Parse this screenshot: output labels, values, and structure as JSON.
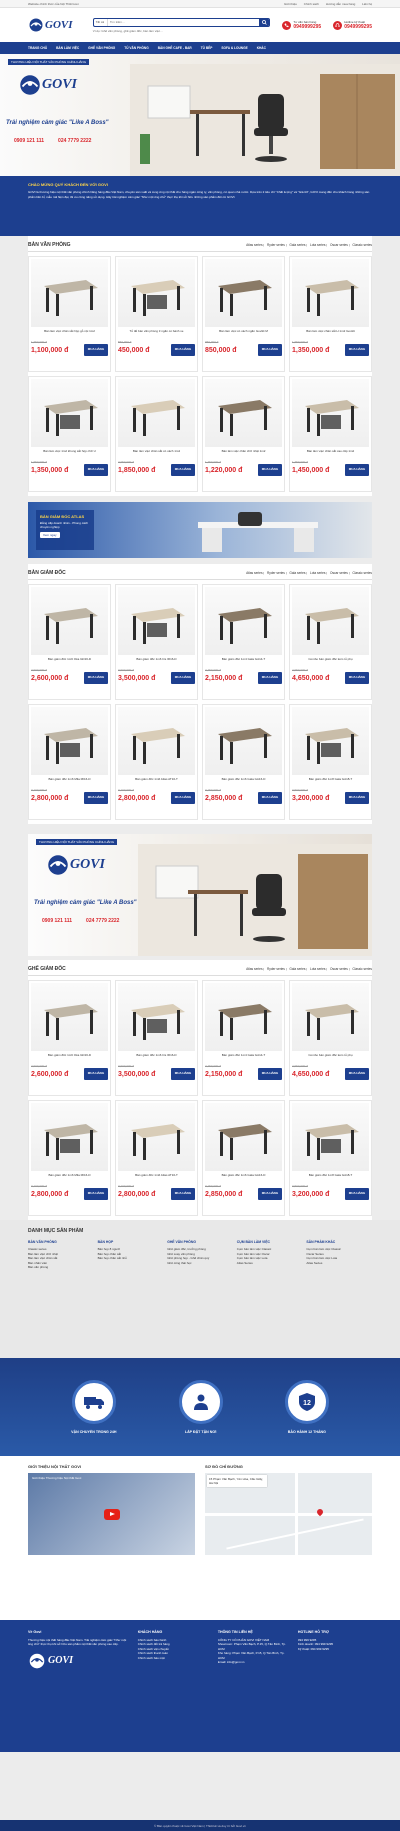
{
  "topbar": {
    "left": "Website chính thức của Nội Thất Govi",
    "links": [
      "Giới thiệu",
      "Chính sách",
      "Hướng dẫn mua hàng",
      "Liên hệ"
    ]
  },
  "header": {
    "logo_text": "GOVI",
    "search_category": "Tất cả",
    "search_placeholder": "Tìm kiếm...",
    "search_hint": "Ví dụ: Ghế văn phòng, ghế giám đốc, bàn làm việc...",
    "hotline_label": "Tư vấn bán hàng",
    "hotline_number": "0949999295",
    "hotline2_label": "Hotline kỹ thuật",
    "hotline2_number": "0949999295"
  },
  "nav": [
    "TRANG CHỦ",
    "BÀN LÀM VIỆC",
    "GHẾ VĂN PHÒNG",
    "TỦ VĂN PHÒNG",
    "BÀN GHẾ CAFE - BAR",
    "TỦ BẾP",
    "SOFA & LOUNGE",
    "KHÁC"
  ],
  "banner": {
    "tag": "THƯƠNG HIỆU NỘI THẤT VĂN PHÒNG CHÍNH HÃNG",
    "brand": "GOVI",
    "slogan": "Trải nghiệm cảm giác \"Like A Boss\"",
    "phone1": "0909 121 111",
    "phone2": "024 7779 2222"
  },
  "welcome": {
    "title": "CHÀO MỪNG QUÝ KHÁCH ĐẾN VỚI GOVI",
    "text": "GOVI là thương hiệu nội thất văn phòng chính hãng hàng đầu Việt Nam, chuyên sản xuất và cung ứng nội thất cho hàng ngàn công ty, văn phòng, cơ quan nhà nước. Dựa trên 2 tiêu chí \"Chất lượng\" và \"Giá tốt\", GOVI mang đến cho khách hàng những sản phẩm bền bỉ, mẫu mã hiện đại, tối ưu công năng sử dụng. Hãy trải nghiệm cảm giác \"Như một ông chủ\" thực thụ khi sở hữu những sản phẩm đến từ GOVI."
  },
  "sections": [
    {
      "title": "BÀN VĂN PHÒNG",
      "tabs": [
        "Atlas series",
        "Ryder series",
        "Gala series",
        "Lota series",
        "Oscar series",
        "Classic series"
      ]
    },
    {
      "title": "BÀN GIÁM ĐỐC",
      "tabs": [
        "Atlas series",
        "Ryder series",
        "Gala series",
        "Lota series",
        "Oscar series",
        "Classic series"
      ]
    },
    {
      "title": "GHẾ GIÁM ĐỐC",
      "tabs": [
        "Atlas series",
        "Ryder series",
        "Gala series",
        "Lota series",
        "Oscar series",
        "Classic series"
      ]
    }
  ],
  "buy_label": "MUA HÀNG",
  "products_office": [
    {
      "name": "Bàn làm việc chân sắt hộp gỗ nội 1m2",
      "old": "1,350,000 đ",
      "price": "1,100,000 đ"
    },
    {
      "name": "Tủ để bàn văn phòng 3 ngăn có bánh xe",
      "old": "550,000 đ",
      "price": "450,000 đ"
    },
    {
      "name": "Bàn làm việc có vách ngăn Goviết M",
      "old": "950,000 đ",
      "price": "850,000 đ"
    },
    {
      "name": "Bàn làm việc chân sắt H 1m2 Goviết",
      "old": "1,650,000 đ",
      "price": "1,350,000 đ"
    },
    {
      "name": "Bàn làm việc 1m2 khung sắt hộp chữ U",
      "old": "1,650,000 đ",
      "price": "1,350,000 đ"
    },
    {
      "name": "Bàn làm việc chân sắt có vách 1m4",
      "old": "2,050,000 đ",
      "price": "1,850,000 đ"
    },
    {
      "name": "Bàn làm việc chân chữ nhật 1m2",
      "old": "1,450,000 đ",
      "price": "1,220,000 đ"
    },
    {
      "name": "Bàn làm việc chân sắt cao cấp 1m2",
      "old": "1,750,000 đ",
      "price": "1,450,000 đ"
    }
  ],
  "promo": {
    "title": "BÀN GIÁM ĐỐC ATLAS",
    "text": "Đẳng cấp doanh nhân - Phong cách chuyên nghiệp",
    "button": "Xem ngay"
  },
  "products_exec": [
    {
      "name": "Bàn giám đốc 1m6 Oka GD16-D",
      "old": "2,900,000 đ",
      "price": "2,600,000 đ"
    },
    {
      "name": "Bàn giám đốc 1m6 Iris IR16-D",
      "old": "3,900,000 đ",
      "price": "3,500,000 đ"
    },
    {
      "name": "Bàn giám đốc 1m4 Gala GA14-T",
      "old": "2,450,000 đ",
      "price": "2,150,000 đ"
    },
    {
      "name": "Combo bàn giám đốc kèm tủ phụ",
      "old": "4,950,000 đ",
      "price": "4,650,000 đ"
    },
    {
      "name": "Bàn giám đốc 1m6 Mila MI16-D",
      "old": "3,100,000 đ",
      "price": "2,800,000 đ"
    },
    {
      "name": "Bàn giám đốc 1m6 Atlas AT16-T",
      "old": "3,100,000 đ",
      "price": "2,800,000 đ"
    },
    {
      "name": "Bàn giám đốc 1m6 Gala GA16-D",
      "old": "3,150,000 đ",
      "price": "2,850,000 đ"
    },
    {
      "name": "Bàn giám đốc 1m8 Gala GA18-T",
      "old": "3,500,000 đ",
      "price": "3,200,000 đ"
    }
  ],
  "products_chair": [
    {
      "name": "Bàn giám đốc 1m6 Oka GD16-D",
      "old": "2,900,000 đ",
      "price": "2,600,000 đ"
    },
    {
      "name": "Bàn giám đốc 1m6 Iris IR16-D",
      "old": "3,900,000 đ",
      "price": "3,500,000 đ"
    },
    {
      "name": "Bàn giám đốc 1m4 Gala GA14-T",
      "old": "2,450,000 đ",
      "price": "2,150,000 đ"
    },
    {
      "name": "Combo bàn giám đốc kèm tủ phụ",
      "old": "4,950,000 đ",
      "price": "4,650,000 đ"
    },
    {
      "name": "Bàn giám đốc 1m6 Mila MI16-D",
      "old": "3,100,000 đ",
      "price": "2,800,000 đ"
    },
    {
      "name": "Bàn giám đốc 1m6 Atlas AT16-T",
      "old": "3,100,000 đ",
      "price": "2,800,000 đ"
    },
    {
      "name": "Bàn giám đốc 1m6 Gala GA16-D",
      "old": "3,150,000 đ",
      "price": "2,850,000 đ"
    },
    {
      "name": "Bàn giám đốc 1m8 Gala GA18-T",
      "old": "3,500,000 đ",
      "price": "3,200,000 đ"
    }
  ],
  "categories": {
    "title": "DANH MỤC SẢN PHẨM",
    "cols": [
      {
        "head": "BÀN VĂN PHÒNG",
        "items": [
          "Classic series",
          "Bàn làm việc chữ nhật",
          "Bàn làm việc chân sắt",
          "Bàn nhân viên",
          "Bàn văn phòng"
        ]
      },
      {
        "head": "BÀN HỌP",
        "items": [
          "Bàn họp 8 người",
          "Bàn họp chân sắt",
          "Bàn họp chân sắt nhỏ"
        ]
      },
      {
        "head": "GHẾ VĂN PHÒNG",
        "items": [
          "Ghế giám đốc, trưởng phòng",
          "Ghế xoay văn phòng",
          "Ghế phòng họp - Ghế chân quỳ",
          "Ghế công thái học"
        ]
      },
      {
        "head": "CỤM BÀN LÀM VIỆC",
        "items": [
          "Cụm bàn làm việc Classic",
          "Cụm bàn làm việc Oscar",
          "Cụm bàn làm việc Lota",
          "Atlas Series"
        ]
      },
      {
        "head": "SẢN PHẨM KHÁC",
        "items": [
          "Cụm bàn làm việc Classic",
          "Oscar Series",
          "Cụm bàn làm việc Lota",
          "Atlas Series"
        ]
      }
    ]
  },
  "services": [
    "VẬN CHUYỂN TRONG 24H",
    "LẮP ĐẶT TẬN NƠI",
    "BẢO HÀNH 12 THÁNG"
  ],
  "intro": {
    "title": "GIỚI THIỆU NỘI THẤT GOVI",
    "video_title": "Giới thiệu Thương hiệu Nội thất Govi"
  },
  "map": {
    "title": "SƠ ĐỒ CHỈ ĐƯỜNG",
    "address": "15 Phạm Văn Bạch, Yên Hòa, Cầu Giấy, Hà Nội"
  },
  "footer": {
    "c1_title": "Về Govi",
    "c1_text": "Thương hiệu nội thất hàng đầu Việt Nam. Trải nghiệm cảm giác \"Như một ông chủ\" thực thụ khi sở hữu sản phẩm nội thất văn phòng cao cấp.",
    "c2_title": "KHÁCH HÀNG",
    "c2_items": [
      "Chính sách bảo hành",
      "Chính sách đổi trả hàng",
      "Chính sách vận chuyển",
      "Chính sách thanh toán",
      "Chính sách bảo mật"
    ],
    "c3_title": "THÔNG TIN LIÊN HỆ",
    "c3_items": [
      "CÔNG TY CỔ PHẦN GOVI VIỆT NAM",
      "Showroom: Phạm Văn Bạch, P.15, Q.Tân Bình, Tp. HCM",
      "Kho hàng: Phạm Văn Bạch, P.15, Q.Tân Bình, Tp. HCM",
      "Email: info@govi.vn"
    ],
    "c4_title": "HOTLINE HỖ TRỢ",
    "c4_items": [
      "094 999 9295",
      "Kinh doanh: 094 999 9295",
      "Kỹ thuật: 094 999 9295"
    ],
    "copyright": "© Bản quyền thuộc về Govi Việt Nam | Thiết kế và duy trì bởi Govi.vn"
  },
  "colors": {
    "brand": "#1d3f8f",
    "price": "#d9262c",
    "accent": "#ffd64a"
  }
}
